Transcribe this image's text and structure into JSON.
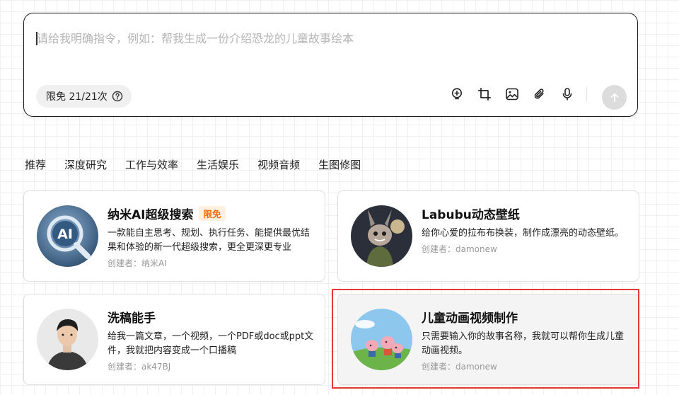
{
  "input": {
    "placeholder": "请给我明确指令，例如：帮我生成一份介绍恐龙的儿童故事绘本",
    "value": ""
  },
  "quota": {
    "label": "限免 21/21次"
  },
  "toolbar": {
    "icons": [
      "add-bulb-icon",
      "crop-icon",
      "image-icon",
      "attach-icon",
      "mic-icon"
    ],
    "send_icon": "arrow-up-icon"
  },
  "tabs": [
    "推荐",
    "深度研究",
    "工作与效率",
    "生活娱乐",
    "视频音频",
    "生图修图"
  ],
  "cards": [
    {
      "title": "纳米AI超级搜索",
      "badge": "限免",
      "desc": "一款能自主思考、规划、执行任务、能提供最优结果和体验的新一代超级搜索，更全更深更专业",
      "author": "创建者：纳米AI",
      "avatar_text": "AI"
    },
    {
      "title": "Labubu动态壁纸",
      "desc": "给你心爱的拉布布换装，制作成漂亮的动态壁纸。",
      "author": "创建者：damonew"
    },
    {
      "title": "洗稿能手",
      "desc": "给我一篇文章，一个视频，一个PDF或doc或ppt文件，我就把内容变成一个口播稿",
      "author": "创建者：ak47BJ"
    },
    {
      "title": "儿童动画视频制作",
      "desc": "只需要输入你的故事名称，我就可以帮你生成儿童动画视频。",
      "author": "创建者：damonew",
      "selected": true
    }
  ],
  "colors": {
    "badge_text": "#ff6a00",
    "badge_bg": "#fff1e0",
    "selection_border": "#e53935",
    "send_button": "#dcdcdc"
  }
}
